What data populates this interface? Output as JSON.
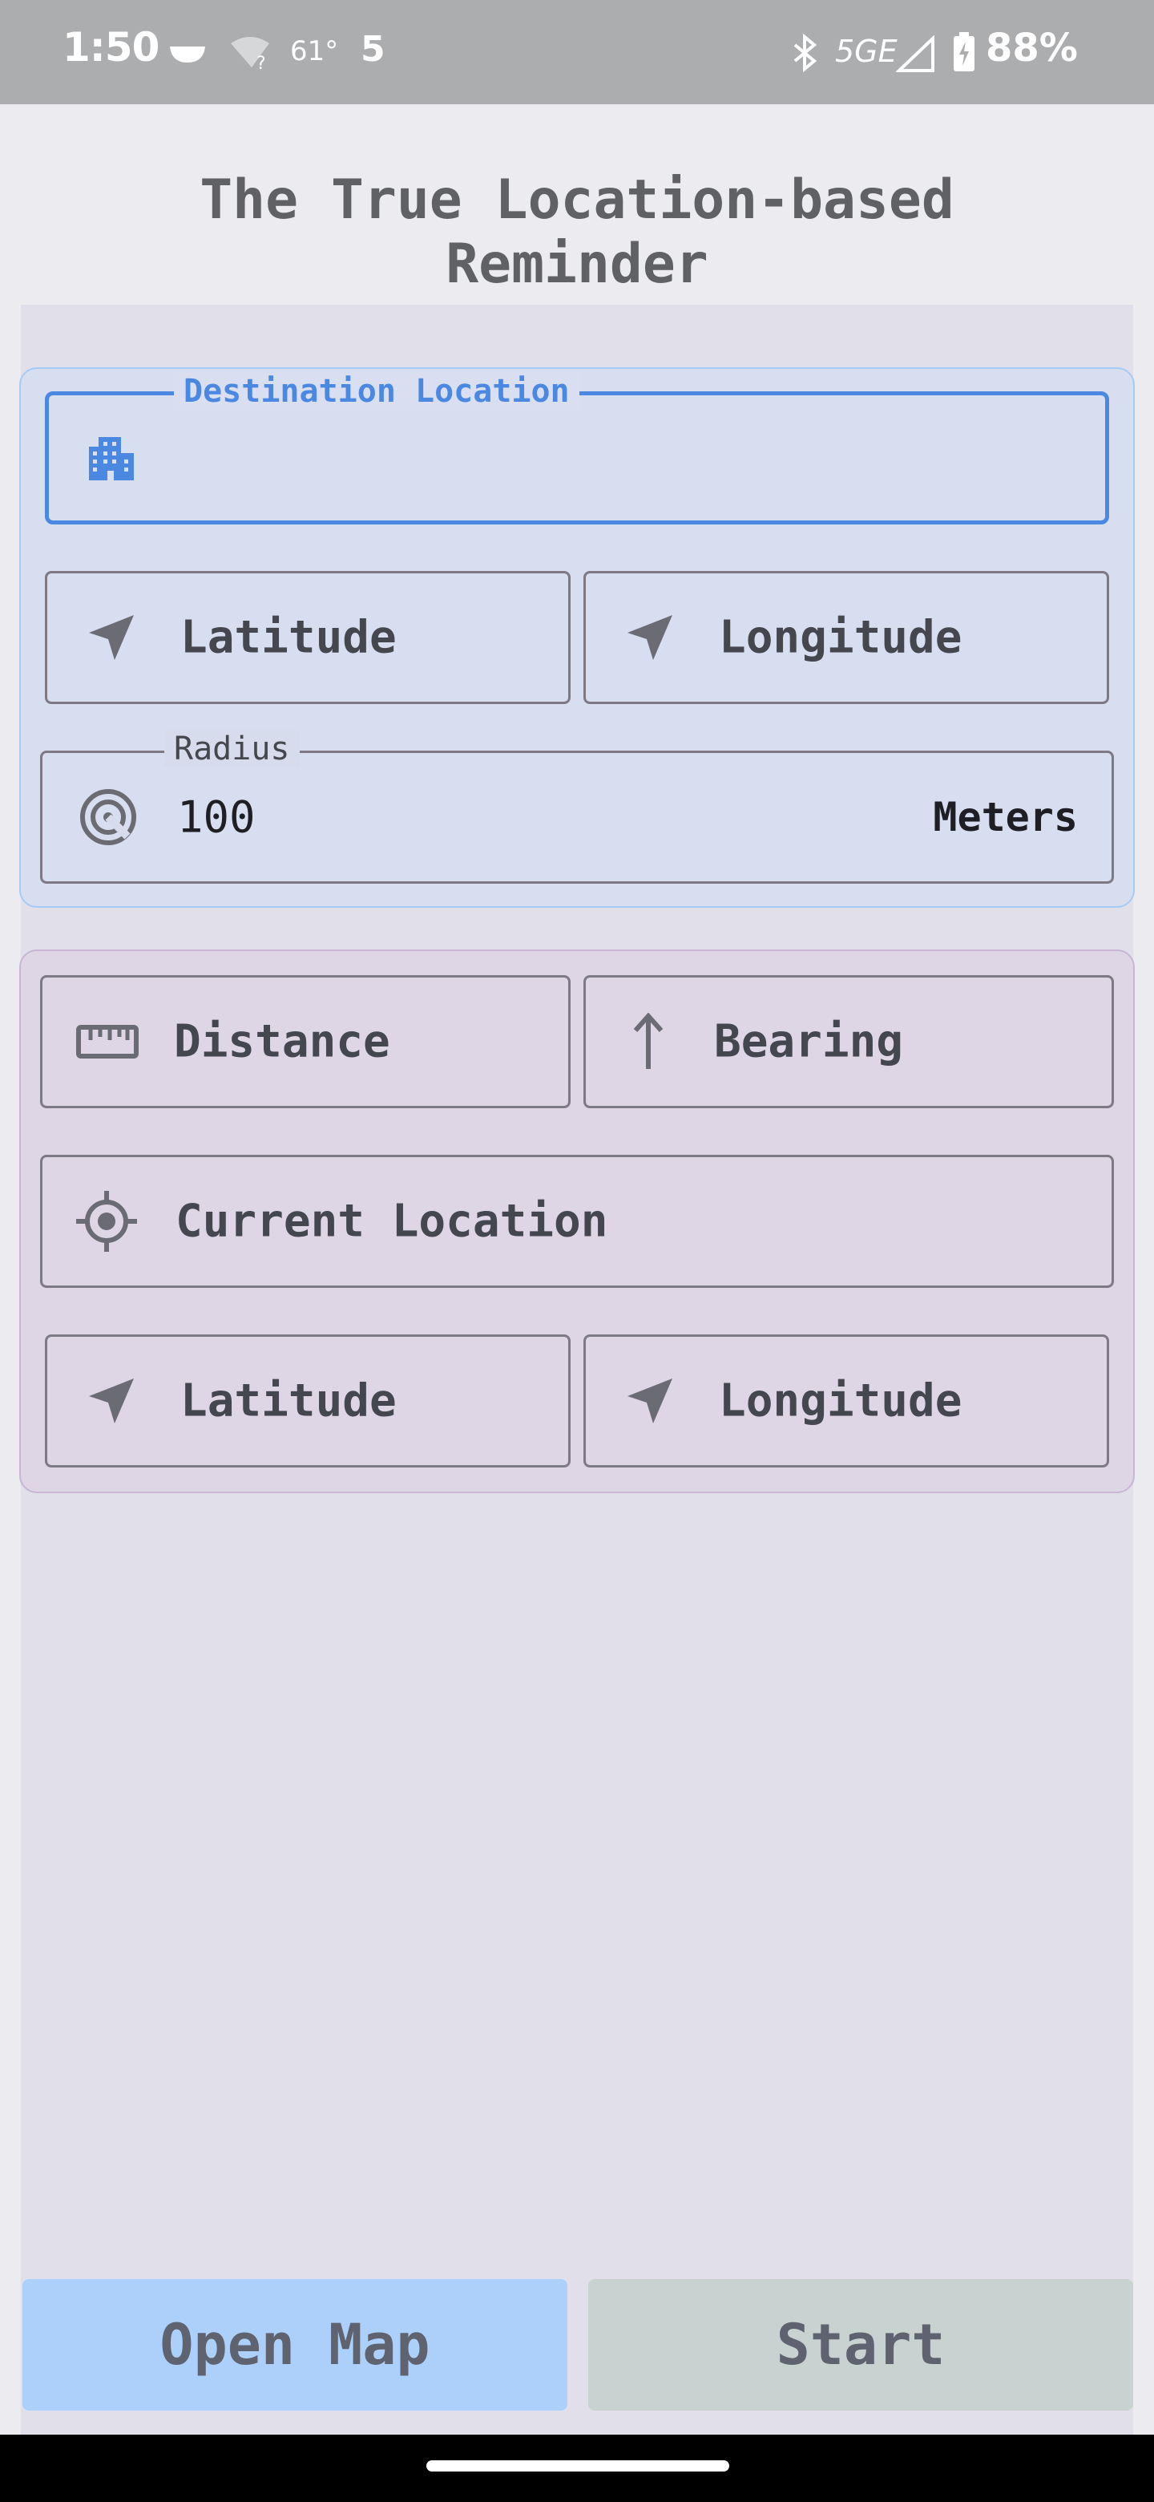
{
  "status_bar": {
    "time": "1:50",
    "temperature": "61°",
    "notification_count": "5",
    "network": "5GE",
    "battery": "88%",
    "icons": [
      "bowl-icon",
      "wifi-unknown-icon",
      "bluetooth-icon",
      "cell-signal-icon",
      "battery-charging-icon"
    ]
  },
  "title": "The True Location-based\nReminder",
  "destination": {
    "legend": "Destination Location",
    "value": "",
    "icon": "building-icon",
    "accent": "#4a88e2",
    "latitude_label": "Latitude",
    "longitude_label": "Longitude",
    "radius": {
      "legend": "Radius",
      "value": "100",
      "unit": "Meters",
      "icon": "radar-icon"
    }
  },
  "live": {
    "distance_label": "Distance",
    "bearing_label": "Bearing",
    "current_location_label": "Current Location",
    "latitude_label": "Latitude",
    "longitude_label": "Longitude",
    "icons": [
      "ruler-icon",
      "arrow-up-icon",
      "crosshair-icon",
      "navigation-arrow-icon"
    ]
  },
  "buttons": {
    "open_map": "Open Map",
    "start": "Start",
    "open_map_color": "#add0fb",
    "start_color": "#c7d2d1"
  }
}
